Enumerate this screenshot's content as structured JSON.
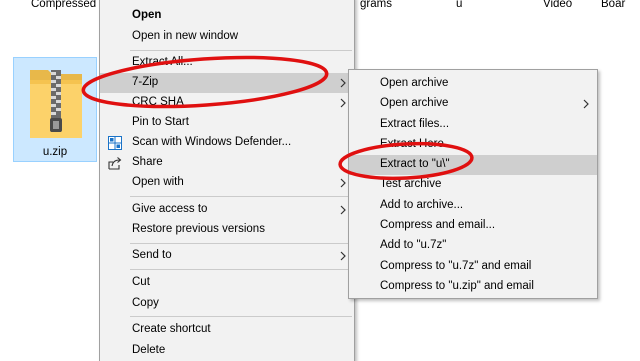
{
  "background_header": {
    "compressed": "Compressed",
    "grams": "grams",
    "u": "u",
    "video": "Video",
    "boar": "Boar"
  },
  "selected_file": {
    "name": "u.zip",
    "icon": "zip-folder-icon"
  },
  "context_menu": {
    "open": "Open",
    "open_new_window": "Open in new window",
    "extract_all": "Extract All...",
    "seven_zip": "7-Zip",
    "crc_sha": "CRC SHA",
    "pin_to_start": "Pin to Start",
    "scan_defender": "Scan with Windows Defender...",
    "share": "Share",
    "open_with": "Open with",
    "give_access": "Give access to",
    "restore_versions": "Restore previous versions",
    "send_to": "Send to",
    "cut": "Cut",
    "copy": "Copy",
    "create_shortcut": "Create shortcut",
    "delete": "Delete"
  },
  "seven_zip_submenu": {
    "open_archive": "Open archive",
    "open_archive_more": "Open archive",
    "extract_files": "Extract files...",
    "extract_here": "Extract Here",
    "extract_to": "Extract to \"u\\\"",
    "test_archive": "Test archive",
    "add_to_archive": "Add to archive...",
    "compress_email": "Compress and email...",
    "add_to_7z": "Add to \"u.7z\"",
    "compress_7z_email": "Compress to \"u.7z\" and email",
    "compress_zip_email": "Compress to \"u.zip\" and email"
  },
  "colors": {
    "menu_bg": "#f2f2f2",
    "menu_highlight": "#cfcfcf",
    "selection_bg": "#cce8ff",
    "annotation_red": "#e01010"
  }
}
